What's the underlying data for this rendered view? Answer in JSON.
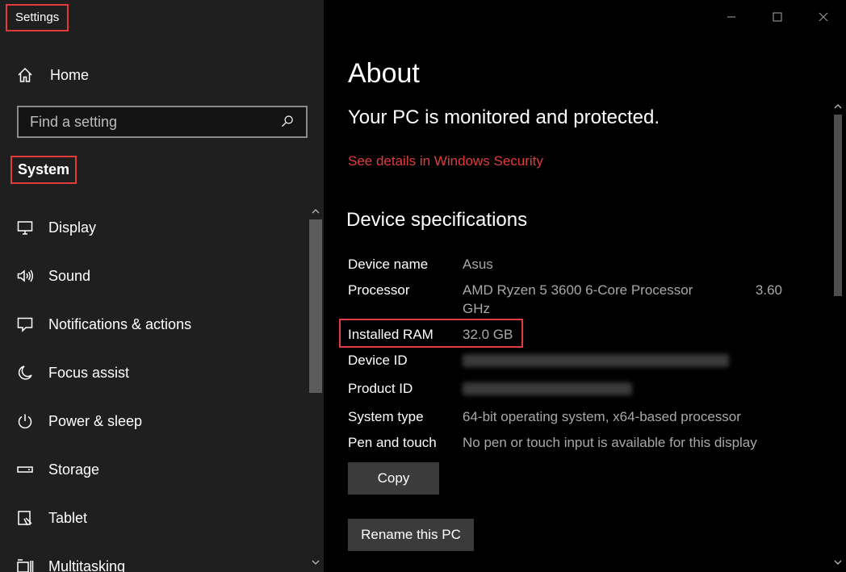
{
  "app": {
    "title": "Settings"
  },
  "sidebar": {
    "home": {
      "label": "Home",
      "icon": "home-icon"
    },
    "search": {
      "placeholder": "Find a setting",
      "icon": "search-icon"
    },
    "section_title": "System",
    "items": [
      {
        "label": "Display",
        "icon": "monitor-icon"
      },
      {
        "label": "Sound",
        "icon": "speaker-icon"
      },
      {
        "label": "Notifications & actions",
        "icon": "notification-icon"
      },
      {
        "label": "Focus assist",
        "icon": "moon-icon"
      },
      {
        "label": "Power & sleep",
        "icon": "power-icon"
      },
      {
        "label": "Storage",
        "icon": "storage-icon"
      },
      {
        "label": "Tablet",
        "icon": "tablet-icon"
      },
      {
        "label": "Multitasking",
        "icon": "multitasking-icon"
      }
    ]
  },
  "main": {
    "title": "About",
    "protection_message": "Your PC is monitored and protected.",
    "security_link": "See details in Windows Security",
    "specs_title": "Device specifications",
    "specs": {
      "device_name": {
        "label": "Device name",
        "value": "Asus"
      },
      "processor": {
        "label": "Processor",
        "value": "AMD Ryzen 5 3600 6-Core Processor",
        "speed": "3.60",
        "unit": "GHz"
      },
      "installed_ram": {
        "label": "Installed RAM",
        "value": "32.0 GB"
      },
      "device_id": {
        "label": "Device ID"
      },
      "product_id": {
        "label": "Product ID"
      },
      "system_type": {
        "label": "System type",
        "value": "64-bit operating system, x64-based processor"
      },
      "pen_touch": {
        "label": "Pen and touch",
        "value": "No pen or touch input is available for this display"
      }
    },
    "buttons": {
      "copy": "Copy",
      "rename": "Rename this PC"
    }
  },
  "colors": {
    "accent_red": "#e23b3b",
    "sidebar_bg": "#1f1f1f",
    "main_bg": "#000000",
    "secondary_text": "#a8a8a8",
    "button_bg": "#3b3b3b"
  }
}
